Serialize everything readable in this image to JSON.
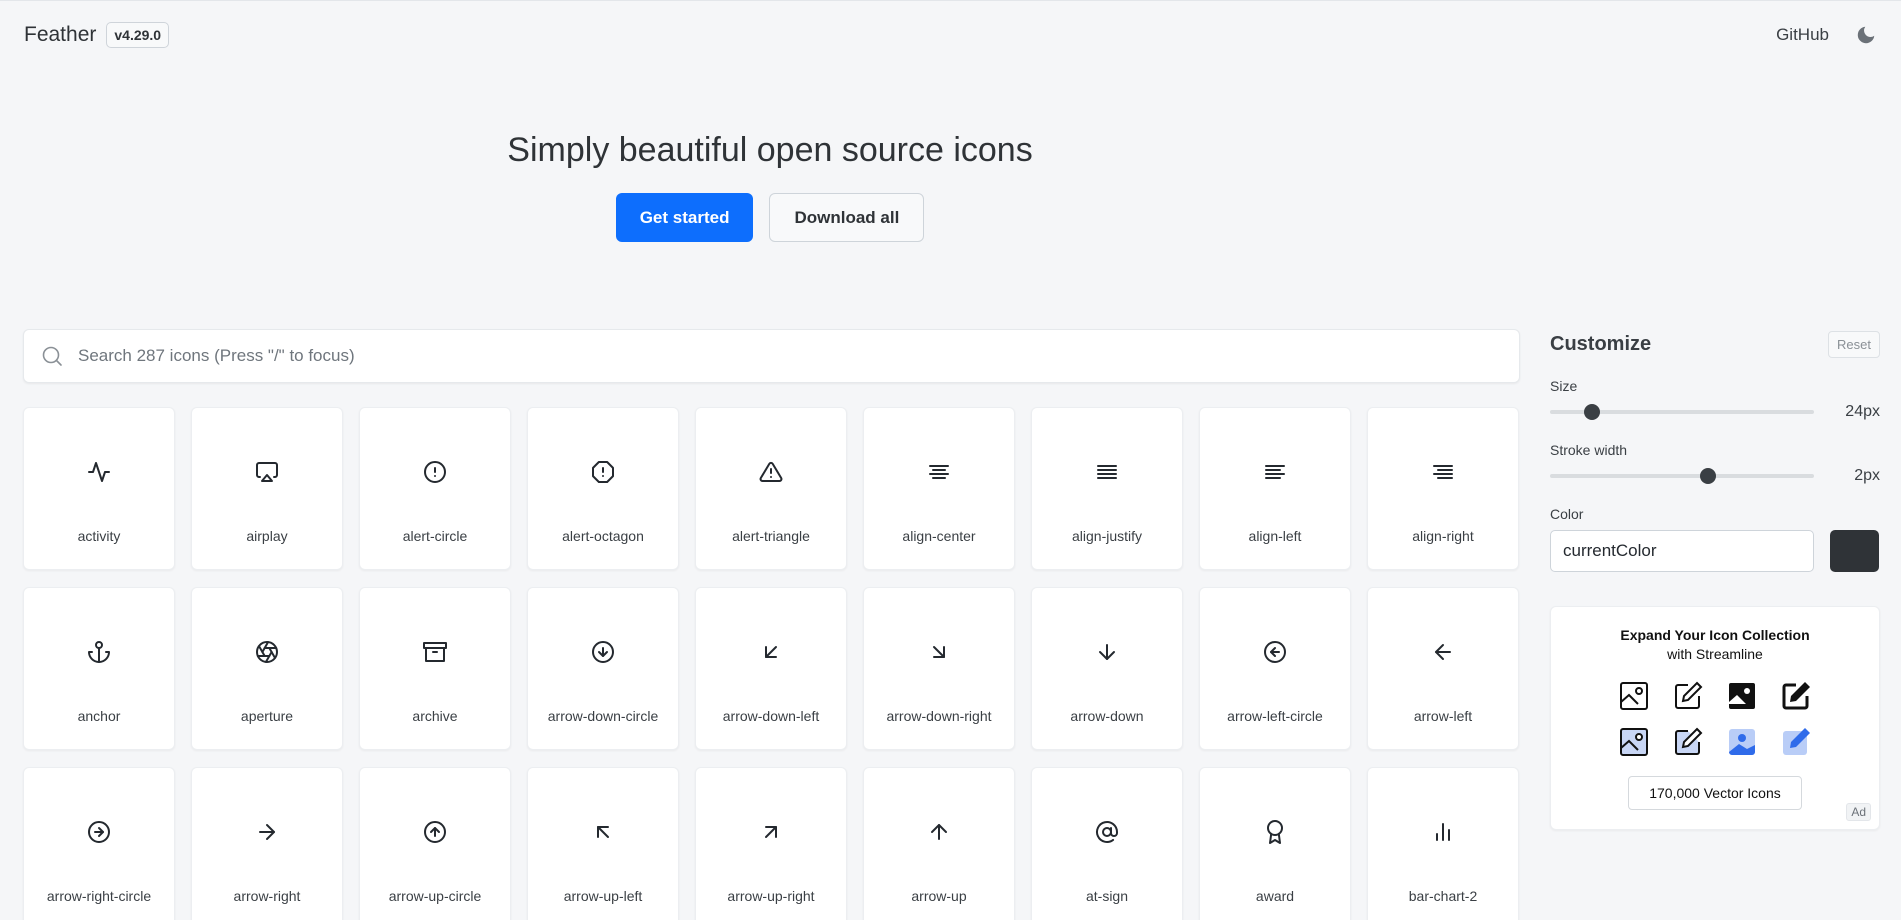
{
  "header": {
    "brand": "Feather",
    "version": "v4.29.0",
    "github_label": "GitHub",
    "theme_icon": "moon-icon"
  },
  "hero": {
    "title": "Simply beautiful open source icons",
    "primary_button": "Get started",
    "secondary_button": "Download all"
  },
  "search": {
    "placeholder": "Search 287 icons (Press \"/\" to focus)",
    "value": "",
    "icon": "search-icon"
  },
  "icons": [
    {
      "label": "activity",
      "icon": "activity-icon"
    },
    {
      "label": "airplay",
      "icon": "airplay-icon"
    },
    {
      "label": "alert-circle",
      "icon": "alert-circle-icon"
    },
    {
      "label": "alert-octagon",
      "icon": "alert-octagon-icon"
    },
    {
      "label": "alert-triangle",
      "icon": "alert-triangle-icon"
    },
    {
      "label": "align-center",
      "icon": "align-center-icon"
    },
    {
      "label": "align-justify",
      "icon": "align-justify-icon"
    },
    {
      "label": "align-left",
      "icon": "align-left-icon"
    },
    {
      "label": "align-right",
      "icon": "align-right-icon"
    },
    {
      "label": "anchor",
      "icon": "anchor-icon"
    },
    {
      "label": "aperture",
      "icon": "aperture-icon"
    },
    {
      "label": "archive",
      "icon": "archive-icon"
    },
    {
      "label": "arrow-down-circle",
      "icon": "arrow-down-circle-icon"
    },
    {
      "label": "arrow-down-left",
      "icon": "arrow-down-left-icon"
    },
    {
      "label": "arrow-down-right",
      "icon": "arrow-down-right-icon"
    },
    {
      "label": "arrow-down",
      "icon": "arrow-down-icon"
    },
    {
      "label": "arrow-left-circle",
      "icon": "arrow-left-circle-icon"
    },
    {
      "label": "arrow-left",
      "icon": "arrow-left-icon"
    },
    {
      "label": "arrow-right-circle",
      "icon": "arrow-right-circle-icon"
    },
    {
      "label": "arrow-right",
      "icon": "arrow-right-icon"
    },
    {
      "label": "arrow-up-circle",
      "icon": "arrow-up-circle-icon"
    },
    {
      "label": "arrow-up-left",
      "icon": "arrow-up-left-icon"
    },
    {
      "label": "arrow-up-right",
      "icon": "arrow-up-right-icon"
    },
    {
      "label": "arrow-up",
      "icon": "arrow-up-icon"
    },
    {
      "label": "at-sign",
      "icon": "at-sign-icon"
    },
    {
      "label": "award",
      "icon": "award-icon"
    },
    {
      "label": "bar-chart-2",
      "icon": "bar-chart-2-icon"
    }
  ],
  "customize": {
    "title": "Customize",
    "reset_label": "Reset",
    "size": {
      "label": "Size",
      "value_label": "24px",
      "fraction": 0.16
    },
    "stroke": {
      "label": "Stroke width",
      "value_label": "2px",
      "fraction": 0.6
    },
    "color": {
      "label": "Color",
      "value": "currentColor",
      "swatch": "#2f3337"
    }
  },
  "ad": {
    "title": "Expand Your Icon Collection",
    "subtitle": "with Streamline",
    "cta": "170,000 Vector Icons",
    "badge": "Ad"
  },
  "colors": {
    "accent": "#0d6efd",
    "background": "#f5f6f8"
  }
}
